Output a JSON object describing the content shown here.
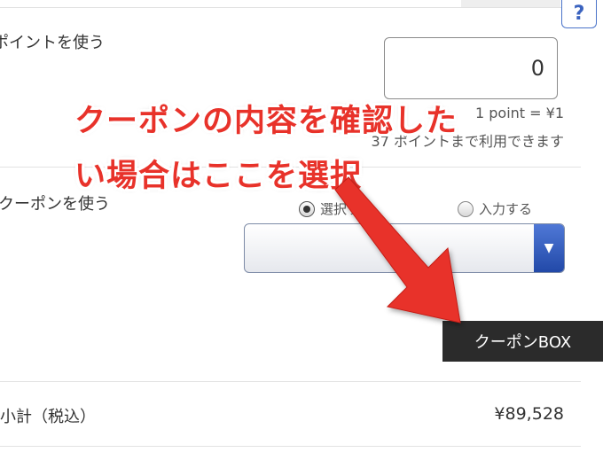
{
  "help": {
    "label": "?"
  },
  "points": {
    "label": "ポイントを使う",
    "input_value": "0",
    "rate": "1 point = ¥1",
    "usable": "37 ポイントまで利用できます"
  },
  "coupon": {
    "label": "クーポンを使う",
    "radio_select": "選択する",
    "radio_input": "入力する",
    "select_value": "",
    "box_button": "クーポンBOX"
  },
  "subtotal": {
    "label": "小計（税込）",
    "value": "¥89,528"
  },
  "annotation": {
    "line1": "クーポンの内容を確認した",
    "line2": "い場合はここを選択"
  },
  "colors": {
    "annotation": "#e8322a",
    "accent": "#3b63bf",
    "button_dark": "#2b2b2b"
  },
  "icons": [
    "help-icon",
    "chevron-down-icon",
    "radio-checked-icon",
    "radio-unchecked-icon",
    "arrow-annotation-icon"
  ]
}
